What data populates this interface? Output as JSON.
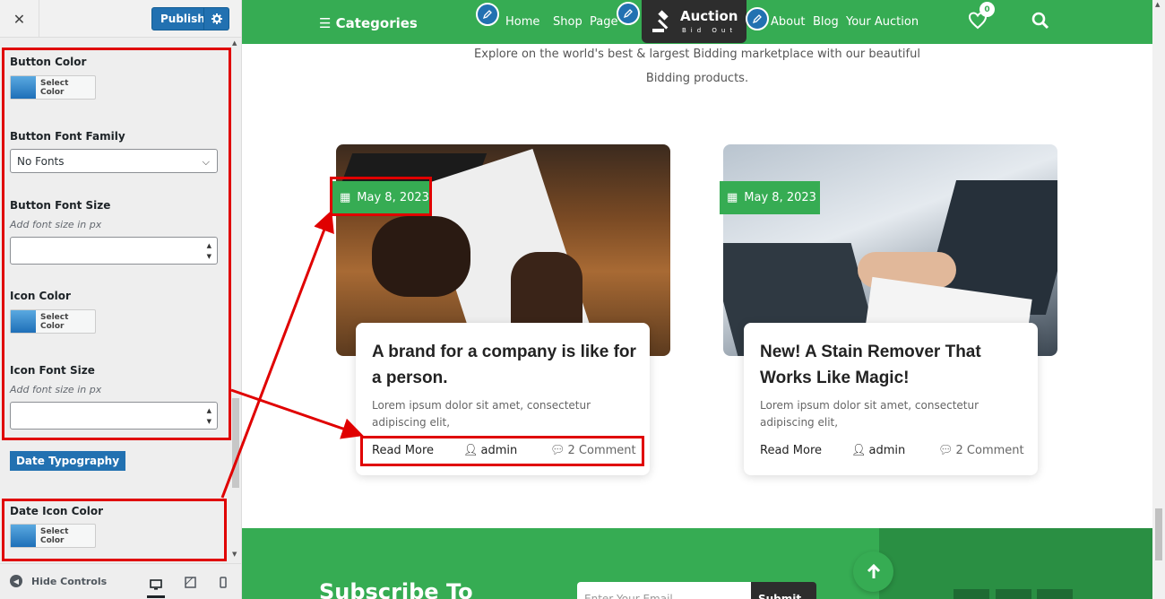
{
  "sidebar": {
    "close_icon": "close-icon",
    "publish_label": "Publish",
    "controls": {
      "button_color_label": "Button Color",
      "select_color": "Select Color",
      "button_font_family_label": "Button Font Family",
      "button_font_family_value": "No Fonts",
      "button_font_size_label": "Button Font Size",
      "font_size_desc": "Add font size in px",
      "icon_color_label": "Icon Color",
      "icon_font_size_label": "Icon Font Size",
      "date_typography_label": "Date Typography",
      "date_icon_color_label": "Date Icon Color"
    },
    "footer": {
      "hide_controls": "Hide Controls"
    }
  },
  "nav": {
    "categories": "Categories",
    "links": [
      "Home",
      "Shop",
      "Page",
      "About",
      "Blog",
      "Your Auction"
    ],
    "logo_name": "Auction",
    "logo_sub": "Bid Out",
    "wishlist_count": "0"
  },
  "intro": {
    "line1": "Explore on the world's best & largest Bidding marketplace with our beautiful",
    "line2": "Bidding products."
  },
  "posts": [
    {
      "date": "May 8, 2023",
      "title": "A brand for a company is like for a person.",
      "excerpt": "Lorem ipsum dolor sit amet, consectetur adipiscing elit,",
      "read_more": "Read More",
      "author": "admin",
      "comments": "2 Comment"
    },
    {
      "date": "May 8, 2023",
      "title": "New! A Stain Remover That Works Like Magic!",
      "excerpt": "Lorem ipsum dolor sit amet, consectetur adipiscing elit,",
      "read_more": "Read More",
      "author": "admin",
      "comments": "2 Comment"
    }
  ],
  "subscribe": {
    "title": "Subscribe To",
    "email_placeholder": "Enter Your Email",
    "button": "Submit"
  },
  "colors": {
    "brand_green": "#36ac53",
    "wp_blue": "#2271b1",
    "highlight_red": "#e00000"
  }
}
